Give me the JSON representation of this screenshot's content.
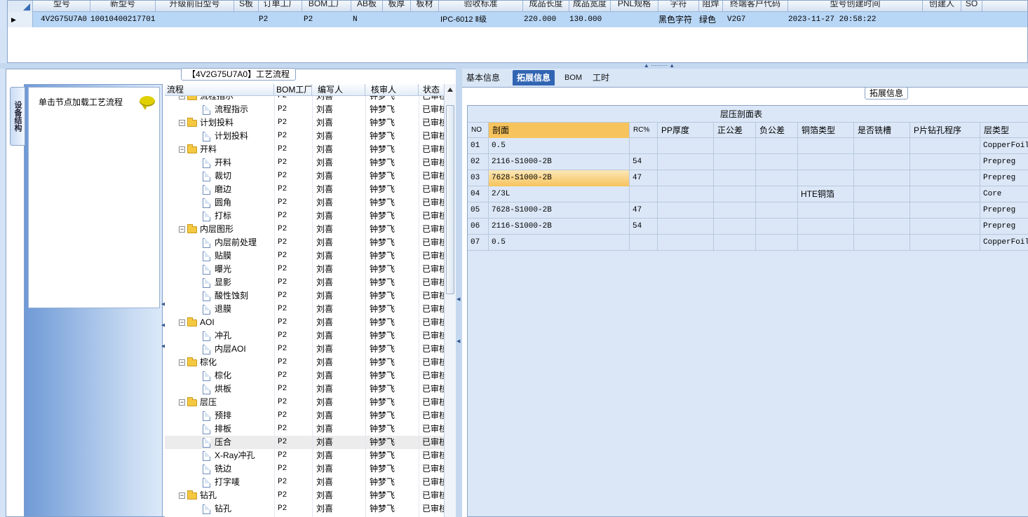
{
  "top_grid": {
    "headers": [
      "型号",
      "新型号",
      "升级前旧型号",
      "S板",
      "订单工厂",
      "BOM工厂",
      "AB板",
      "板厚",
      "板材",
      "验收标准",
      "成品长度",
      "成品宽度",
      "PNL规格",
      "字符",
      "阻焊",
      "终端客户代码",
      "型号创建时间",
      "创建人",
      "SO"
    ],
    "row": {
      "model": "4V2G75U7A0",
      "new_model": "10010400217701",
      "order_factory": "P2",
      "bom_factory": "P2",
      "ab_board": "N",
      "standard": "IPC-6012 Ⅱ级",
      "length": "220.000",
      "width": "130.000",
      "char": "黑色字符",
      "mask": "绿色",
      "customer_code": "V2G7",
      "created_time": "2023-11-27 20:58:22"
    }
  },
  "process": {
    "title": "【4V2G75U7A0】工艺流程",
    "side_tab": "设备结构",
    "hint": "单击节点加载工艺流程",
    "columns": [
      "流程",
      "BOM工厂",
      "编写人",
      "核审人",
      "状态"
    ],
    "rows": [
      {
        "name": "流程指示",
        "level": 0,
        "factory": "P2",
        "writer": "刘喜",
        "reviewer": "钟梦飞",
        "status": "已审核"
      },
      {
        "name": "流程指示",
        "level": 1,
        "factory": "P2",
        "writer": "刘喜",
        "reviewer": "钟梦飞",
        "status": "已审核"
      },
      {
        "name": "计划投料",
        "level": 0,
        "factory": "P2",
        "writer": "刘喜",
        "reviewer": "钟梦飞",
        "status": "已审核"
      },
      {
        "name": "计划投料",
        "level": 1,
        "factory": "P2",
        "writer": "刘喜",
        "reviewer": "钟梦飞",
        "status": "已审核"
      },
      {
        "name": "开料",
        "level": 0,
        "factory": "P2",
        "writer": "刘喜",
        "reviewer": "钟梦飞",
        "status": "已审核"
      },
      {
        "name": "开料",
        "level": 1,
        "factory": "P2",
        "writer": "刘喜",
        "reviewer": "钟梦飞",
        "status": "已审核"
      },
      {
        "name": "裁切",
        "level": 1,
        "factory": "P2",
        "writer": "刘喜",
        "reviewer": "钟梦飞",
        "status": "已审核"
      },
      {
        "name": "磨边",
        "level": 1,
        "factory": "P2",
        "writer": "刘喜",
        "reviewer": "钟梦飞",
        "status": "已审核"
      },
      {
        "name": "圆角",
        "level": 1,
        "factory": "P2",
        "writer": "刘喜",
        "reviewer": "钟梦飞",
        "status": "已审核"
      },
      {
        "name": "打标",
        "level": 1,
        "factory": "P2",
        "writer": "刘喜",
        "reviewer": "钟梦飞",
        "status": "已审核"
      },
      {
        "name": "内层图形",
        "level": 0,
        "factory": "P2",
        "writer": "刘喜",
        "reviewer": "钟梦飞",
        "status": "已审核"
      },
      {
        "name": "内层前处理",
        "level": 1,
        "factory": "P2",
        "writer": "刘喜",
        "reviewer": "钟梦飞",
        "status": "已审核"
      },
      {
        "name": "贴膜",
        "level": 1,
        "factory": "P2",
        "writer": "刘喜",
        "reviewer": "钟梦飞",
        "status": "已审核"
      },
      {
        "name": "曝光",
        "level": 1,
        "factory": "P2",
        "writer": "刘喜",
        "reviewer": "钟梦飞",
        "status": "已审核"
      },
      {
        "name": "显影",
        "level": 1,
        "factory": "P2",
        "writer": "刘喜",
        "reviewer": "钟梦飞",
        "status": "已审核"
      },
      {
        "name": "酸性蚀刻",
        "level": 1,
        "factory": "P2",
        "writer": "刘喜",
        "reviewer": "钟梦飞",
        "status": "已审核"
      },
      {
        "name": "退膜",
        "level": 1,
        "factory": "P2",
        "writer": "刘喜",
        "reviewer": "钟梦飞",
        "status": "已审核"
      },
      {
        "name": "AOI",
        "level": 0,
        "factory": "P2",
        "writer": "刘喜",
        "reviewer": "钟梦飞",
        "status": "已审核"
      },
      {
        "name": "冲孔",
        "level": 1,
        "factory": "P2",
        "writer": "刘喜",
        "reviewer": "钟梦飞",
        "status": "已审核"
      },
      {
        "name": "内层AOI",
        "level": 1,
        "factory": "P2",
        "writer": "刘喜",
        "reviewer": "钟梦飞",
        "status": "已审核"
      },
      {
        "name": "棕化",
        "level": 0,
        "factory": "P2",
        "writer": "刘喜",
        "reviewer": "钟梦飞",
        "status": "已审核"
      },
      {
        "name": "棕化",
        "level": 1,
        "factory": "P2",
        "writer": "刘喜",
        "reviewer": "钟梦飞",
        "status": "已审核"
      },
      {
        "name": "烘板",
        "level": 1,
        "factory": "P2",
        "writer": "刘喜",
        "reviewer": "钟梦飞",
        "status": "已审核"
      },
      {
        "name": "层压",
        "level": 0,
        "factory": "P2",
        "writer": "刘喜",
        "reviewer": "钟梦飞",
        "status": "已审核"
      },
      {
        "name": "预排",
        "level": 1,
        "factory": "P2",
        "writer": "刘喜",
        "reviewer": "钟梦飞",
        "status": "已审核"
      },
      {
        "name": "排板",
        "level": 1,
        "factory": "P2",
        "writer": "刘喜",
        "reviewer": "钟梦飞",
        "status": "已审核"
      },
      {
        "name": "压合",
        "level": 1,
        "factory": "P2",
        "writer": "刘喜",
        "reviewer": "钟梦飞",
        "status": "已审核",
        "selected": true
      },
      {
        "name": "X-Ray冲孔",
        "level": 1,
        "factory": "P2",
        "writer": "刘喜",
        "reviewer": "钟梦飞",
        "status": "已审核"
      },
      {
        "name": "铣边",
        "level": 1,
        "factory": "P2",
        "writer": "刘喜",
        "reviewer": "钟梦飞",
        "status": "已审核"
      },
      {
        "name": "打字唛",
        "level": 1,
        "factory": "P2",
        "writer": "刘喜",
        "reviewer": "钟梦飞",
        "status": "已审核"
      },
      {
        "name": "钻孔",
        "level": 0,
        "factory": "P2",
        "writer": "刘喜",
        "reviewer": "钟梦飞",
        "status": "已审核"
      },
      {
        "name": "钻孔",
        "level": 1,
        "factory": "P2",
        "writer": "刘喜",
        "reviewer": "钟梦飞",
        "status": "已审核"
      }
    ]
  },
  "detail": {
    "tabs": [
      "基本信息",
      "拓展信息",
      "BOM",
      "工时"
    ],
    "active_tab": "拓展信息",
    "section_label": "拓展信息",
    "table_caption": "层压剖面表",
    "columns": [
      "NO",
      "剖面",
      "RC%",
      "PP厚度",
      "正公差",
      "负公差",
      "铜箔类型",
      "是否铣槽",
      "P片钻孔程序",
      "层类型"
    ],
    "rows": [
      {
        "no": "01",
        "profile": "0.5",
        "rc": "",
        "pp": "",
        "pos": "",
        "neg": "",
        "foil": "",
        "slot": "",
        "prog": "",
        "type": "CopperFoil"
      },
      {
        "no": "02",
        "profile": "2116-S1000-2B",
        "rc": "54",
        "pp": "",
        "pos": "",
        "neg": "",
        "foil": "",
        "slot": "",
        "prog": "",
        "type": "Prepreg"
      },
      {
        "no": "03",
        "profile": "7628-S1000-2B",
        "rc": "47",
        "pp": "",
        "pos": "",
        "neg": "",
        "foil": "",
        "slot": "",
        "prog": "",
        "type": "Prepreg",
        "selected": true
      },
      {
        "no": "04",
        "profile": "2/3L",
        "rc": "",
        "pp": "",
        "pos": "",
        "neg": "",
        "foil": "HTE铜箔",
        "slot": "",
        "prog": "",
        "type": "Core"
      },
      {
        "no": "05",
        "profile": "7628-S1000-2B",
        "rc": "47",
        "pp": "",
        "pos": "",
        "neg": "",
        "foil": "",
        "slot": "",
        "prog": "",
        "type": "Prepreg"
      },
      {
        "no": "06",
        "profile": "2116-S1000-2B",
        "rc": "54",
        "pp": "",
        "pos": "",
        "neg": "",
        "foil": "",
        "slot": "",
        "prog": "",
        "type": "Prepreg"
      },
      {
        "no": "07",
        "profile": "0.5",
        "rc": "",
        "pp": "",
        "pos": "",
        "neg": "",
        "foil": "",
        "slot": "",
        "prog": "",
        "type": "CopperFoil"
      }
    ]
  }
}
